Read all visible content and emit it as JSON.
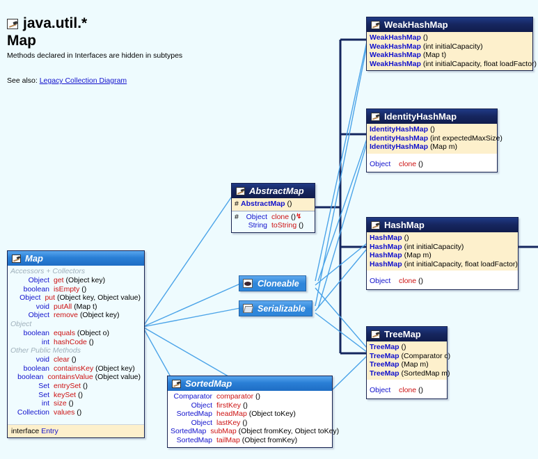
{
  "header": {
    "package_icon": "package-icon",
    "package": "java.util.*",
    "class": "Map",
    "note": "Methods declared in Interfaces are hidden in subtypes",
    "see_also_label": "See also:",
    "see_also_link": "Legacy Collection Diagram"
  },
  "colors": {
    "background": "#eefbfe",
    "class_header": "#16265f",
    "interface_header": "#2a7fd6",
    "constructor_band": "#fdf0cc",
    "body": "#f0fcff",
    "return_type": "#1111cc",
    "method_name": "#cc1111",
    "group_label": "#9fb0bb",
    "inheritance_line": "#14265e",
    "implements_line": "#4aa3e8"
  },
  "boxes": {
    "map": {
      "name": "Map",
      "kind": "interface",
      "groups": [
        {
          "label": "Accessors + Collectors",
          "members": [
            {
              "ret": "Object",
              "name": "get",
              "sig": "(Object key)"
            },
            {
              "ret": "boolean",
              "name": "isEmpty",
              "sig": "()"
            },
            {
              "ret": "Object",
              "name": "put",
              "sig": "(Object key, Object value)"
            },
            {
              "ret": "void",
              "name": "putAll",
              "sig": "(Map t)"
            },
            {
              "ret": "Object",
              "name": "remove",
              "sig": "(Object key)"
            }
          ]
        },
        {
          "label": "Object",
          "members": [
            {
              "ret": "boolean",
              "name": "equals",
              "sig": "(Object o)"
            },
            {
              "ret": "int",
              "name": "hashCode",
              "sig": "()"
            }
          ]
        },
        {
          "label": "Other Public Methods",
          "members": [
            {
              "ret": "void",
              "name": "clear",
              "sig": "()"
            },
            {
              "ret": "boolean",
              "name": "containsKey",
              "sig": "(Object key)"
            },
            {
              "ret": "boolean",
              "name": "containsValue",
              "sig": "(Object value)"
            },
            {
              "ret": "Set",
              "name": "entrySet",
              "sig": "()"
            },
            {
              "ret": "Set",
              "name": "keySet",
              "sig": "()"
            },
            {
              "ret": "int",
              "name": "size",
              "sig": "()"
            },
            {
              "ret": "Collection",
              "name": "values",
              "sig": "()"
            }
          ]
        }
      ],
      "nested": {
        "keyword": "interface",
        "name": "Entry"
      }
    },
    "abstractmap": {
      "name": "AbstractMap",
      "kind": "class",
      "abstract": true,
      "constructors": [
        {
          "vis": "#",
          "name": "AbstractMap",
          "sig": "()"
        }
      ],
      "methods": [
        {
          "vis": "#",
          "ret": "Object",
          "name": "clone",
          "sig": "()",
          "throws": true
        },
        {
          "vis": "",
          "ret": "String",
          "name": "toString",
          "sig": "()"
        }
      ]
    },
    "weakhashmap": {
      "name": "WeakHashMap",
      "kind": "class",
      "constructors": [
        {
          "name": "WeakHashMap",
          "sig": "()"
        },
        {
          "name": "WeakHashMap",
          "sig": "(int initialCapacity)"
        },
        {
          "name": "WeakHashMap",
          "sig": "(Map t)"
        },
        {
          "name": "WeakHashMap",
          "sig": "(int initialCapacity, float loadFactor)"
        }
      ],
      "methods": []
    },
    "identityhashmap": {
      "name": "IdentityHashMap",
      "kind": "class",
      "constructors": [
        {
          "name": "IdentityHashMap",
          "sig": "()"
        },
        {
          "name": "IdentityHashMap",
          "sig": "(int expectedMaxSize)"
        },
        {
          "name": "IdentityHashMap",
          "sig": "(Map m)"
        }
      ],
      "methods": [
        {
          "ret": "Object",
          "name": "clone",
          "sig": "()"
        }
      ]
    },
    "hashmap": {
      "name": "HashMap",
      "kind": "class",
      "constructors": [
        {
          "name": "HashMap",
          "sig": "()"
        },
        {
          "name": "HashMap",
          "sig": "(int initialCapacity)"
        },
        {
          "name": "HashMap",
          "sig": "(Map m)"
        },
        {
          "name": "HashMap",
          "sig": "(int initialCapacity, float loadFactor)"
        }
      ],
      "methods": [
        {
          "ret": "Object",
          "name": "clone",
          "sig": "()"
        }
      ]
    },
    "treemap": {
      "name": "TreeMap",
      "kind": "class",
      "constructors": [
        {
          "name": "TreeMap",
          "sig": "()"
        },
        {
          "name": "TreeMap",
          "sig": "(Comparator c)"
        },
        {
          "name": "TreeMap",
          "sig": "(Map m)"
        },
        {
          "name": "TreeMap",
          "sig": "(SortedMap m)"
        }
      ],
      "methods": [
        {
          "ret": "Object",
          "name": "clone",
          "sig": "()"
        }
      ]
    },
    "sortedmap": {
      "name": "SortedMap",
      "kind": "interface",
      "groups": [
        {
          "label": "",
          "members": [
            {
              "ret": "Comparator",
              "name": "comparator",
              "sig": "()"
            },
            {
              "ret": "Object",
              "name": "firstKey",
              "sig": "()"
            },
            {
              "ret": "SortedMap",
              "name": "headMap",
              "sig": "(Object toKey)"
            },
            {
              "ret": "Object",
              "name": "lastKey",
              "sig": "()"
            },
            {
              "ret": "SortedMap",
              "name": "subMap",
              "sig": "(Object fromKey, Object toKey)"
            },
            {
              "ret": "SortedMap",
              "name": "tailMap",
              "sig": "(Object fromKey)"
            }
          ]
        }
      ]
    },
    "cloneable": {
      "name": "Cloneable",
      "kind": "interface",
      "icon": "cloneable-icon"
    },
    "serializable": {
      "name": "Serializable",
      "kind": "interface",
      "icon": "serializable-icon"
    }
  }
}
